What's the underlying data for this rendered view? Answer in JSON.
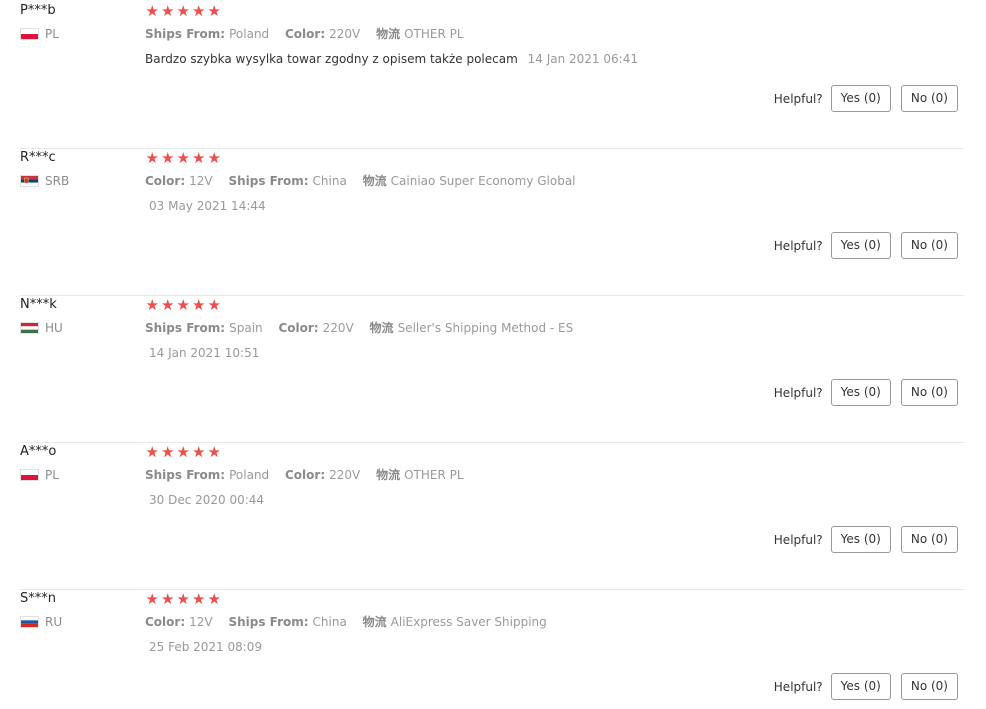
{
  "colors": {
    "star": "#ee4e4e",
    "divider": "#e8e8e8",
    "muted_text": "#999999"
  },
  "reviews": [
    {
      "buyer": "P***b",
      "country": "PL",
      "flag_icon": "poland-flag-icon",
      "rating": 5,
      "attributes": [
        {
          "key": "Ships From:",
          "value": "Poland"
        },
        {
          "key": "Color:",
          "value": "220V"
        },
        {
          "key": "物流",
          "value": "OTHER PL"
        }
      ],
      "content": "Bardzo szybka wysylka towar zgodny z opisem także polecam",
      "date": "14 Jan 2021 06:41",
      "helpful_label": "Helpful?",
      "yes_label": "Yes (0)",
      "no_label": "No (0)"
    },
    {
      "buyer": "R***c",
      "country": "SRB",
      "flag_icon": "serbia-flag-icon",
      "rating": 5,
      "attributes": [
        {
          "key": "Color:",
          "value": "12V"
        },
        {
          "key": "Ships From:",
          "value": "China"
        },
        {
          "key": "物流",
          "value": "Cainiao Super Economy Global"
        }
      ],
      "content": "",
      "date": "03 May 2021 14:44",
      "helpful_label": "Helpful?",
      "yes_label": "Yes (0)",
      "no_label": "No (0)"
    },
    {
      "buyer": "N***k",
      "country": "HU",
      "flag_icon": "hungary-flag-icon",
      "rating": 5,
      "attributes": [
        {
          "key": "Ships From:",
          "value": "Spain"
        },
        {
          "key": "Color:",
          "value": "220V"
        },
        {
          "key": "物流",
          "value": "Seller's Shipping Method - ES"
        }
      ],
      "content": "",
      "date": "14 Jan 2021 10:51",
      "helpful_label": "Helpful?",
      "yes_label": "Yes (0)",
      "no_label": "No (0)"
    },
    {
      "buyer": "A***o",
      "country": "PL",
      "flag_icon": "poland-flag-icon",
      "rating": 5,
      "attributes": [
        {
          "key": "Ships From:",
          "value": "Poland"
        },
        {
          "key": "Color:",
          "value": "220V"
        },
        {
          "key": "物流",
          "value": "OTHER PL"
        }
      ],
      "content": "",
      "date": "30 Dec 2020 00:44",
      "helpful_label": "Helpful?",
      "yes_label": "Yes (0)",
      "no_label": "No (0)"
    },
    {
      "buyer": "S***n",
      "country": "RU",
      "flag_icon": "russia-flag-icon",
      "rating": 5,
      "attributes": [
        {
          "key": "Color:",
          "value": "12V"
        },
        {
          "key": "Ships From:",
          "value": "China"
        },
        {
          "key": "物流",
          "value": "AliExpress Saver Shipping"
        }
      ],
      "content": "",
      "date": "25 Feb 2021 08:09",
      "helpful_label": "Helpful?",
      "yes_label": "Yes (0)",
      "no_label": "No (0)"
    }
  ]
}
